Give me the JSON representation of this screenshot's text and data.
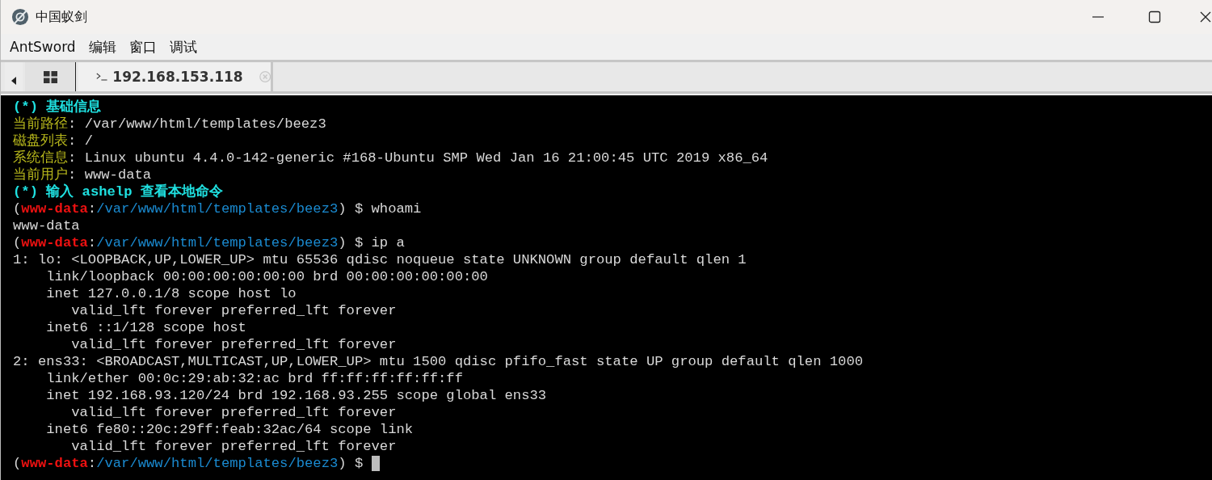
{
  "window": {
    "title": "中国蚁剑"
  },
  "menu": [
    "AntSword",
    "编辑",
    "窗口",
    "调试"
  ],
  "tabs": [
    {
      "kind": "home",
      "selected": false
    },
    {
      "kind": "shell",
      "label": "192.168.153.118",
      "selected": true
    }
  ],
  "terminal": {
    "cursor": true,
    "lines": [
      [
        {
          "kind": "heading",
          "text": "(*) 基础信息"
        }
      ],
      [
        {
          "kind": "label",
          "text": "当前路径"
        },
        {
          "kind": "text",
          "text": ": /var/www/html/templates/beez3"
        }
      ],
      [
        {
          "kind": "label",
          "text": "磁盘列表"
        },
        {
          "kind": "text",
          "text": ": /"
        }
      ],
      [
        {
          "kind": "label",
          "text": "系统信息"
        },
        {
          "kind": "text",
          "text": ": Linux ubuntu 4.4.0-142-generic #168-Ubuntu SMP Wed Jan 16 21:00:45 UTC 2019 x86_64"
        }
      ],
      [
        {
          "kind": "label",
          "text": "当前用户"
        },
        {
          "kind": "text",
          "text": ": www-data"
        }
      ],
      [
        {
          "kind": "heading",
          "text": "(*) 输入 ashelp 查看本地命令"
        }
      ],
      [
        {
          "kind": "text",
          "text": "("
        },
        {
          "kind": "user",
          "text": "www-data"
        },
        {
          "kind": "text",
          "text": ":"
        },
        {
          "kind": "path",
          "text": "/var/www/html/templates/beez3"
        },
        {
          "kind": "text",
          "text": ") $ whoami"
        }
      ],
      [
        {
          "kind": "text",
          "text": "www-data"
        }
      ],
      [
        {
          "kind": "text",
          "text": "("
        },
        {
          "kind": "user",
          "text": "www-data"
        },
        {
          "kind": "text",
          "text": ":"
        },
        {
          "kind": "path",
          "text": "/var/www/html/templates/beez3"
        },
        {
          "kind": "text",
          "text": ") $ ip a"
        }
      ],
      [
        {
          "kind": "text",
          "text": "1: lo: <LOOPBACK,UP,LOWER_UP> mtu 65536 qdisc noqueue state UNKNOWN group default qlen 1"
        }
      ],
      [
        {
          "kind": "text",
          "text": "    link/loopback 00:00:00:00:00:00 brd 00:00:00:00:00:00"
        }
      ],
      [
        {
          "kind": "text",
          "text": "    inet 127.0.0.1/8 scope host lo"
        }
      ],
      [
        {
          "kind": "text",
          "text": "       valid_lft forever preferred_lft forever"
        }
      ],
      [
        {
          "kind": "text",
          "text": "    inet6 ::1/128 scope host"
        }
      ],
      [
        {
          "kind": "text",
          "text": "       valid_lft forever preferred_lft forever"
        }
      ],
      [
        {
          "kind": "text",
          "text": "2: ens33: <BROADCAST,MULTICAST,UP,LOWER_UP> mtu 1500 qdisc pfifo_fast state UP group default qlen 1000"
        }
      ],
      [
        {
          "kind": "text",
          "text": "    link/ether 00:0c:29:ab:32:ac brd ff:ff:ff:ff:ff:ff"
        }
      ],
      [
        {
          "kind": "text",
          "text": "    inet 192.168.93.120/24 brd 192.168.93.255 scope global ens33"
        }
      ],
      [
        {
          "kind": "text",
          "text": "       valid_lft forever preferred_lft forever"
        }
      ],
      [
        {
          "kind": "text",
          "text": "    inet6 fe80::20c:29ff:feab:32ac/64 scope link"
        }
      ],
      [
        {
          "kind": "text",
          "text": "       valid_lft forever preferred_lft forever"
        }
      ],
      [
        {
          "kind": "text",
          "text": "("
        },
        {
          "kind": "user",
          "text": "www-data"
        },
        {
          "kind": "text",
          "text": ":"
        },
        {
          "kind": "path",
          "text": "/var/www/html/templates/beez3"
        },
        {
          "kind": "text",
          "text": ") $ "
        }
      ]
    ]
  }
}
